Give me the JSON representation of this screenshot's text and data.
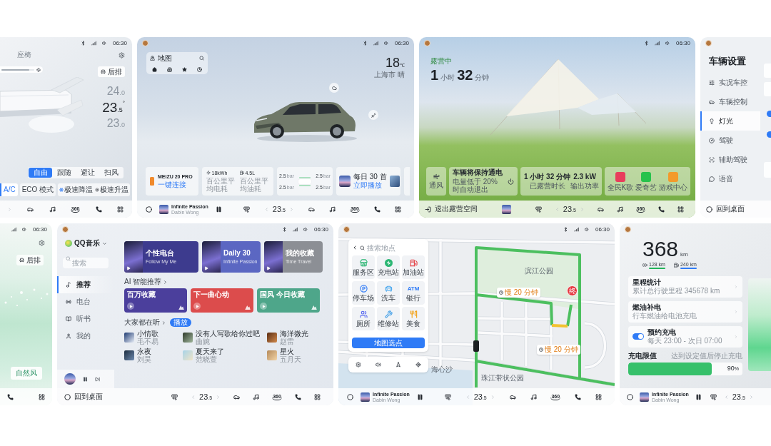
{
  "climate_screen": {
    "status_bar": {
      "time": "06:30"
    },
    "title": "座椅",
    "fan_bar": {
      "level": 0.85
    },
    "rear_button": "后排",
    "temperatures": [
      {
        "value": "24",
        "decimal": ".0",
        "selected": false
      },
      {
        "value": "23",
        "decimal": ".5",
        "unit": "°",
        "selected": true
      },
      {
        "value": "23",
        "decimal": ".0",
        "selected": false
      }
    ],
    "modes": [
      {
        "label": "自由",
        "selected": true
      },
      {
        "label": "跟随",
        "selected": false
      },
      {
        "label": "避让",
        "selected": false
      },
      {
        "label": "扫风",
        "selected": false
      }
    ],
    "toggles": [
      {
        "label": "A/C",
        "on": true
      },
      {
        "label": "ECO 模式",
        "on": false
      }
    ],
    "quick_actions": [
      {
        "kind": "cool",
        "label": "极速降温"
      },
      {
        "kind": "heat",
        "label": "极速升温"
      }
    ],
    "dock": [
      {
        "kind": "next"
      },
      {
        "kind": "car"
      },
      {
        "kind": "music"
      },
      {
        "kind": "surround",
        "label": "360"
      },
      {
        "kind": "phone"
      },
      {
        "kind": "apps"
      }
    ]
  },
  "home_screen": {
    "status_bar": {
      "time": "06:30"
    },
    "map_widget": {
      "title": "地图"
    },
    "weather": {
      "temperature": "18",
      "unit": "℃",
      "location": "上海市 晴"
    },
    "cards": [
      {
        "kind": "phone",
        "title": "MEIZU 20 PRO",
        "action": "一键连接"
      },
      {
        "kind": "energy",
        "stats": [
          {
            "kind": "electric",
            "value": "18kWh",
            "label": "百公里平均电耗"
          },
          {
            "kind": "fuel",
            "value": "4.5L",
            "label": "百公里平均油耗"
          }
        ]
      },
      {
        "kind": "tires",
        "pressures": [
          {
            "value": "2.5",
            "unit": "bar"
          },
          {
            "value": "2.5",
            "unit": "bar"
          },
          {
            "value": "2.5",
            "unit": "bar"
          },
          {
            "value": "2.5",
            "unit": "bar"
          }
        ]
      },
      {
        "kind": "playlist",
        "title": "每日 30 首",
        "action": "立即播放"
      }
    ],
    "dock": [
      {
        "kind": "home"
      },
      {
        "kind": "player",
        "title": "Infinite Passion",
        "artist": "Dabin Wong"
      },
      {
        "kind": "pause"
      },
      {
        "kind": "vent"
      },
      {
        "kind": "temp",
        "value": "23",
        "decimal": ".5"
      },
      {
        "kind": "car"
      },
      {
        "kind": "music"
      },
      {
        "kind": "surround",
        "label": "360"
      },
      {
        "kind": "phone"
      },
      {
        "kind": "apps"
      }
    ]
  },
  "camping_screen": {
    "status_bar": {
      "time": "06:30"
    },
    "status": "露营中",
    "duration": [
      {
        "value": "1",
        "unit": "小时"
      },
      {
        "value": "32",
        "unit": "分钟"
      }
    ],
    "cards": [
      {
        "kind": "fan",
        "label": "通风"
      },
      {
        "kind": "power",
        "title": "车辆将保持通电",
        "subtitle": "电量低于 20% 时自动退出"
      },
      {
        "kind": "stats",
        "items": [
          {
            "value": "1 小时 32 分钟",
            "label": "已露营时长"
          },
          {
            "value": "2.3 kW",
            "label": "输出功率"
          }
        ]
      },
      {
        "kind": "apps",
        "apps": [
          {
            "label": "全民K歌",
            "color": "#e83e5c"
          },
          {
            "label": "爱奇艺",
            "color": "#27c24c"
          },
          {
            "label": "游戏中心",
            "color": "#f39a2b"
          }
        ]
      }
    ],
    "dock": [
      {
        "kind": "exit",
        "label": "退出露营空间"
      },
      {
        "kind": "album"
      },
      {
        "kind": "vent"
      },
      {
        "kind": "temp",
        "value": "23",
        "decimal": ".5"
      },
      {
        "kind": "car"
      },
      {
        "kind": "music"
      },
      {
        "kind": "surround",
        "label": "360"
      },
      {
        "kind": "phone"
      },
      {
        "kind": "apps"
      }
    ]
  },
  "settings_screen": {
    "title": "车辆设置",
    "menu": [
      {
        "kind": "controls",
        "label": "实况车控",
        "selected": false
      },
      {
        "kind": "car",
        "label": "车辆控制",
        "selected": false
      },
      {
        "kind": "light",
        "label": "灯光",
        "selected": true
      },
      {
        "kind": "drive",
        "label": "驾驶",
        "selected": false
      },
      {
        "kind": "assist",
        "label": "辅助驾驶",
        "selected": false
      },
      {
        "kind": "voice",
        "label": "语音",
        "selected": false
      }
    ],
    "switches": [
      {
        "on": true
      },
      {
        "on": true
      }
    ],
    "dock": [
      {
        "kind": "desktop",
        "label": "回到桌面"
      }
    ]
  },
  "ambient_screen": {
    "status_bar": {
      "time": "06:30"
    },
    "rear_button": "后排",
    "mode_button": "自然风",
    "dock": [
      {
        "kind": "phone"
      },
      {
        "kind": "apps"
      }
    ]
  },
  "music_screen": {
    "status_bar": {
      "time": "06:30"
    },
    "app_name": "QQ音乐",
    "search": {
      "placeholder": "搜索"
    },
    "nav": [
      {
        "kind": "recommend",
        "label": "推荐",
        "selected": true
      },
      {
        "kind": "radio",
        "label": "电台",
        "selected": false
      },
      {
        "kind": "audiobook",
        "label": "听书",
        "selected": false
      },
      {
        "kind": "mine",
        "label": "我的",
        "selected": false
      }
    ],
    "featured": [
      {
        "title": "个性电台",
        "subtitle": "Follow My Me",
        "color": "#3d3b8e"
      },
      {
        "title": "Daily 30",
        "subtitle": "Infinite Passion",
        "color": "#5b67c2"
      },
      {
        "title": "我的收藏",
        "subtitle": "Time Travel",
        "color": "#8c8f95"
      }
    ],
    "ai_section": "AI 智能推荐",
    "ai_playlists": [
      {
        "title": "百万收藏",
        "color": "#4b3f9c"
      },
      {
        "title": "下一曲心动",
        "color": "#dc4c4c"
      },
      {
        "title": "国风 今日收藏",
        "color": "#4ea68a"
      }
    ],
    "popular": {
      "title": "大家都在听",
      "badge": "播放"
    },
    "songs": [
      {
        "title": "小情歌",
        "artist": "毛不易"
      },
      {
        "title": "没有人写歌给你过吧",
        "artist": "曲婉"
      },
      {
        "title": "海洋微光",
        "artist": "赵雷"
      },
      {
        "title": "永夜",
        "artist": "刘昊"
      },
      {
        "title": "夏天来了",
        "artist": "范晓萱"
      },
      {
        "title": "星火",
        "artist": "五月天"
      }
    ],
    "dock": [
      {
        "kind": "desktop",
        "label": "回到桌面"
      },
      {
        "kind": "vent"
      },
      {
        "kind": "temp",
        "value": "23",
        "decimal": ".5"
      },
      {
        "kind": "car"
      },
      {
        "kind": "music"
      },
      {
        "kind": "surround",
        "label": "360"
      },
      {
        "kind": "phone"
      },
      {
        "kind": "apps"
      }
    ]
  },
  "map_screen": {
    "status_bar": {
      "time": "06:30"
    },
    "search": {
      "placeholder": "搜索地点"
    },
    "categories": [
      {
        "kind": "service",
        "label": "服务区"
      },
      {
        "kind": "charging",
        "label": "充电站"
      },
      {
        "kind": "gas",
        "label": "加油站"
      },
      {
        "kind": "parking",
        "label": "停车场"
      },
      {
        "kind": "carwash",
        "label": "洗车"
      },
      {
        "kind": "atm",
        "label": "银行"
      },
      {
        "kind": "toilet",
        "label": "厕所"
      },
      {
        "kind": "repair",
        "label": "维修站"
      },
      {
        "kind": "food",
        "label": "美食"
      }
    ],
    "atm_icon_text": "ATM",
    "pick_button": "地图选点",
    "route_labels": [
      "慢 20 分钟",
      "慢 20 分钟"
    ],
    "destination": {
      "label": "终"
    },
    "places": [
      {
        "label": "滨江公园"
      },
      {
        "label": "珠江带状公园"
      },
      {
        "label": "海心沙"
      }
    ],
    "dock": [
      {
        "kind": "home"
      },
      {
        "kind": "player",
        "title": "Infinite Passion",
        "artist": "Dabin Wong"
      },
      {
        "kind": "pause"
      },
      {
        "kind": "vent"
      },
      {
        "kind": "temp",
        "value": "23",
        "decimal": ".5"
      },
      {
        "kind": "car"
      },
      {
        "kind": "music"
      },
      {
        "kind": "surround",
        "label": "360"
      },
      {
        "kind": "phone"
      },
      {
        "kind": "apps"
      }
    ]
  },
  "energy_screen": {
    "range": {
      "value": "368",
      "unit": "km"
    },
    "sources": [
      {
        "kind": "battery",
        "reading": "128 km",
        "color": "#22b45a"
      },
      {
        "kind": "fuel",
        "reading": "240 km",
        "color": "#2f7bf6"
      }
    ],
    "rows": [
      {
        "kind": "link",
        "title": "里程统计",
        "subtitle": "累计总行驶里程 345678 km"
      },
      {
        "kind": "link",
        "title": "燃油补电",
        "subtitle": "行车燃油给电池充电"
      },
      {
        "kind": "switch",
        "title": "预约充电",
        "subtitle": "每天 23:00 - 次日 07:00",
        "on": true
      }
    ],
    "charge_limit": {
      "title": "充电限值",
      "hint": "达到设定值后停止充电",
      "level": 0.9,
      "reading": "90",
      "unit": "%"
    },
    "dock": [
      {
        "kind": "home"
      },
      {
        "kind": "player",
        "title": "Infinite Passion",
        "artist": "Dabin Wong"
      },
      {
        "kind": "pause"
      },
      {
        "kind": "vent"
      },
      {
        "kind": "temp",
        "value": "23",
        "decimal": ".5"
      }
    ]
  }
}
